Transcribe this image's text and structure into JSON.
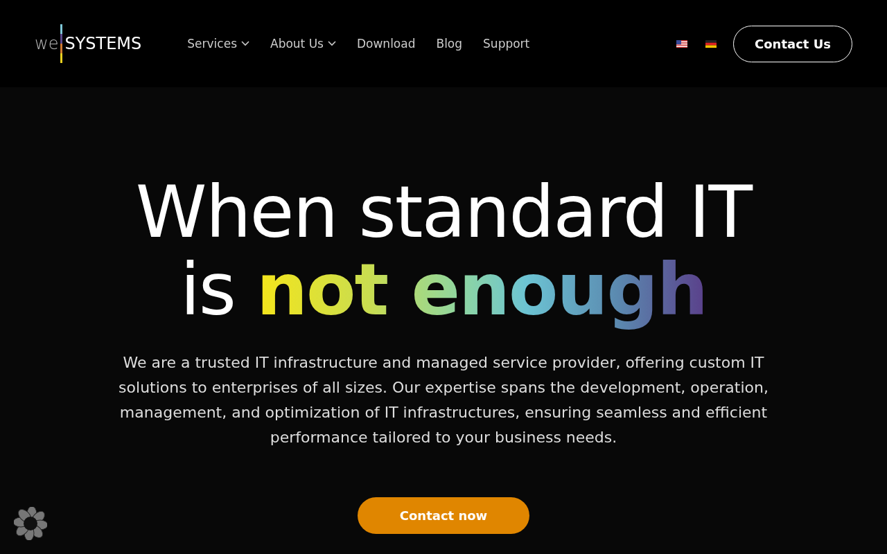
{
  "header": {
    "logo": {
      "prefix": "we",
      "name": "SYSTEMS"
    },
    "nav": [
      {
        "label": "Services",
        "has_dropdown": true
      },
      {
        "label": "About Us",
        "has_dropdown": true
      },
      {
        "label": "Download",
        "has_dropdown": false
      },
      {
        "label": "Blog",
        "has_dropdown": false
      },
      {
        "label": "Support",
        "has_dropdown": false
      }
    ],
    "languages": [
      {
        "kind": "us"
      },
      {
        "kind": "de"
      }
    ],
    "cta": "Contact Us"
  },
  "hero": {
    "headline_line1": "When standard IT",
    "headline_prefix": "is",
    "headline_highlight": "not enough",
    "text": "We are a trusted IT infrastructure and managed service provider, offering custom IT solutions to enterprises of all sizes. Our expertise spans the development, operation, management, and optimization of IT infrastructures, ensuring seamless and efficient performance tailored to your business needs.",
    "button": "Contact now"
  }
}
